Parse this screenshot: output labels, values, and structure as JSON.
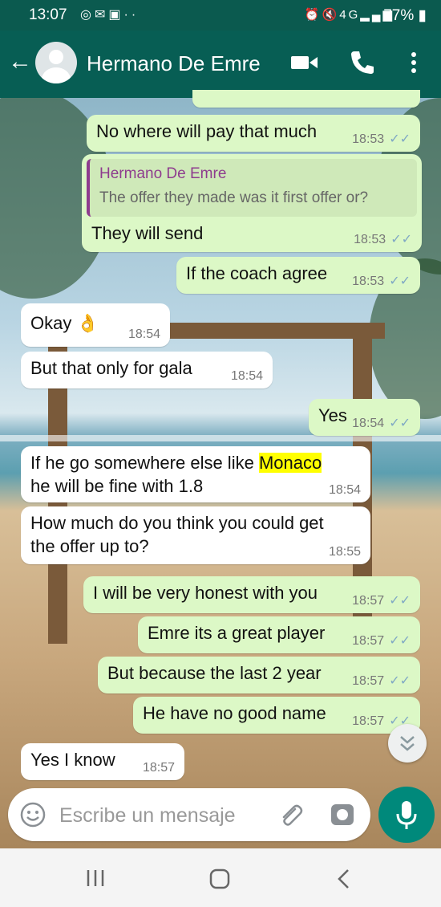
{
  "status_bar": {
    "time": "13:07",
    "left_icons": [
      "instagram-icon",
      "gmail-icon",
      "linkedin-icon",
      "more-dots"
    ],
    "right_icons": [
      "alarm-icon",
      "mute-icon",
      "4g-icon",
      "signal-icon"
    ],
    "battery": "77%"
  },
  "header": {
    "contact_name": "Hermano De Emre",
    "icons": [
      "back-arrow-icon",
      "avatar",
      "video-call-icon",
      "voice-call-icon",
      "more-vert-icon"
    ],
    "bg_color": "#075e54"
  },
  "messages": [
    {
      "dir": "out",
      "text": "No where will pay that much",
      "time": "18:53",
      "read": true
    },
    {
      "dir": "out",
      "quote_name": "Hermano De Emre",
      "quote_text": "The offer they made was it first offer or?",
      "text": "They will send",
      "time": "18:53",
      "read": true
    },
    {
      "dir": "out",
      "text": "If the coach agree",
      "time": "18:53",
      "read": true
    },
    {
      "dir": "in",
      "text": "Okay 👌",
      "time": "18:54"
    },
    {
      "dir": "in",
      "text": "But that only for gala",
      "time": "18:54"
    },
    {
      "dir": "out",
      "text": "Yes",
      "time": "18:54",
      "read": true
    },
    {
      "dir": "in",
      "line1_pre": "If he go somewhere else like ",
      "line1_hl": "Monaco",
      "line2": "he will be fine with 1.8",
      "time": "18:54"
    },
    {
      "dir": "in",
      "line1": "How much do you think you could get",
      "line2": "the offer up to?",
      "time": "18:55"
    },
    {
      "dir": "out",
      "text": "I will be very honest with you",
      "time": "18:57",
      "read": true
    },
    {
      "dir": "out",
      "text": "Emre its a great player",
      "time": "18:57",
      "read": true
    },
    {
      "dir": "out",
      "text": "But because the last 2 year",
      "time": "18:57",
      "read": true
    },
    {
      "dir": "out",
      "text": "He have no good name",
      "time": "18:57",
      "read": true
    },
    {
      "dir": "in",
      "text": "Yes I know",
      "time": "18:57"
    }
  ],
  "input": {
    "placeholder": "Escribe un mensaje"
  },
  "colors": {
    "outgoing": "#dcf8c6",
    "incoming": "#ffffff",
    "accent": "#00897b",
    "highlight": "#ffff00",
    "read_ticks": "#7fa8c4"
  },
  "ticks_glyph": "✓✓"
}
